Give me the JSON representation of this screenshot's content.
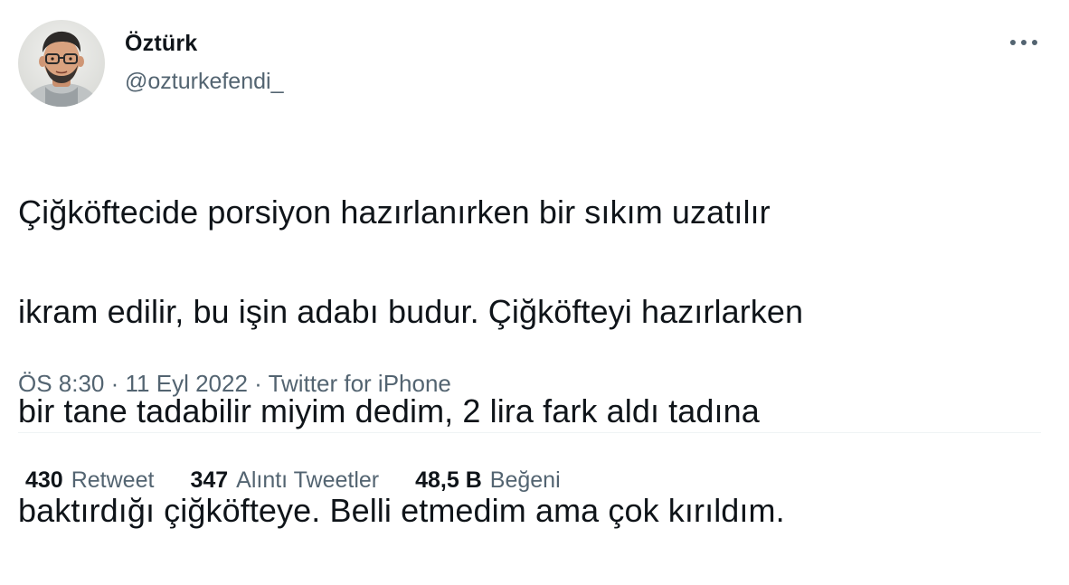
{
  "user": {
    "display_name": "Öztürk",
    "handle": "@ozturkefendi_"
  },
  "tweet": {
    "lines": [
      "Çiğköftecide porsiyon hazırlanırken bir sıkım uzatılır",
      "ikram edilir, bu işin adabı budur. Çiğköfteyi hazırlarken",
      "bir tane tadabilir miyim dedim, 2 lira fark aldı tadına",
      "baktırdığı çiğköfteye. Belli etmedim ama çok kırıldım."
    ]
  },
  "meta": {
    "time": "ÖS 8:30",
    "separator": " · ",
    "date": "11 Eyl 2022",
    "source": "Twitter for iPhone"
  },
  "stats": {
    "retweets": {
      "count": "430",
      "label": "Retweet"
    },
    "quotes": {
      "count": "347",
      "label": "Alıntı Tweetler"
    },
    "likes": {
      "count": "48,5 B",
      "label": "Beğeni"
    }
  },
  "icons": {
    "more": "more-horizontal-icon",
    "avatar": "user-avatar-photo"
  },
  "colors": {
    "text_primary": "#0f1419",
    "text_secondary": "#536471",
    "divider": "#eff3f4"
  }
}
